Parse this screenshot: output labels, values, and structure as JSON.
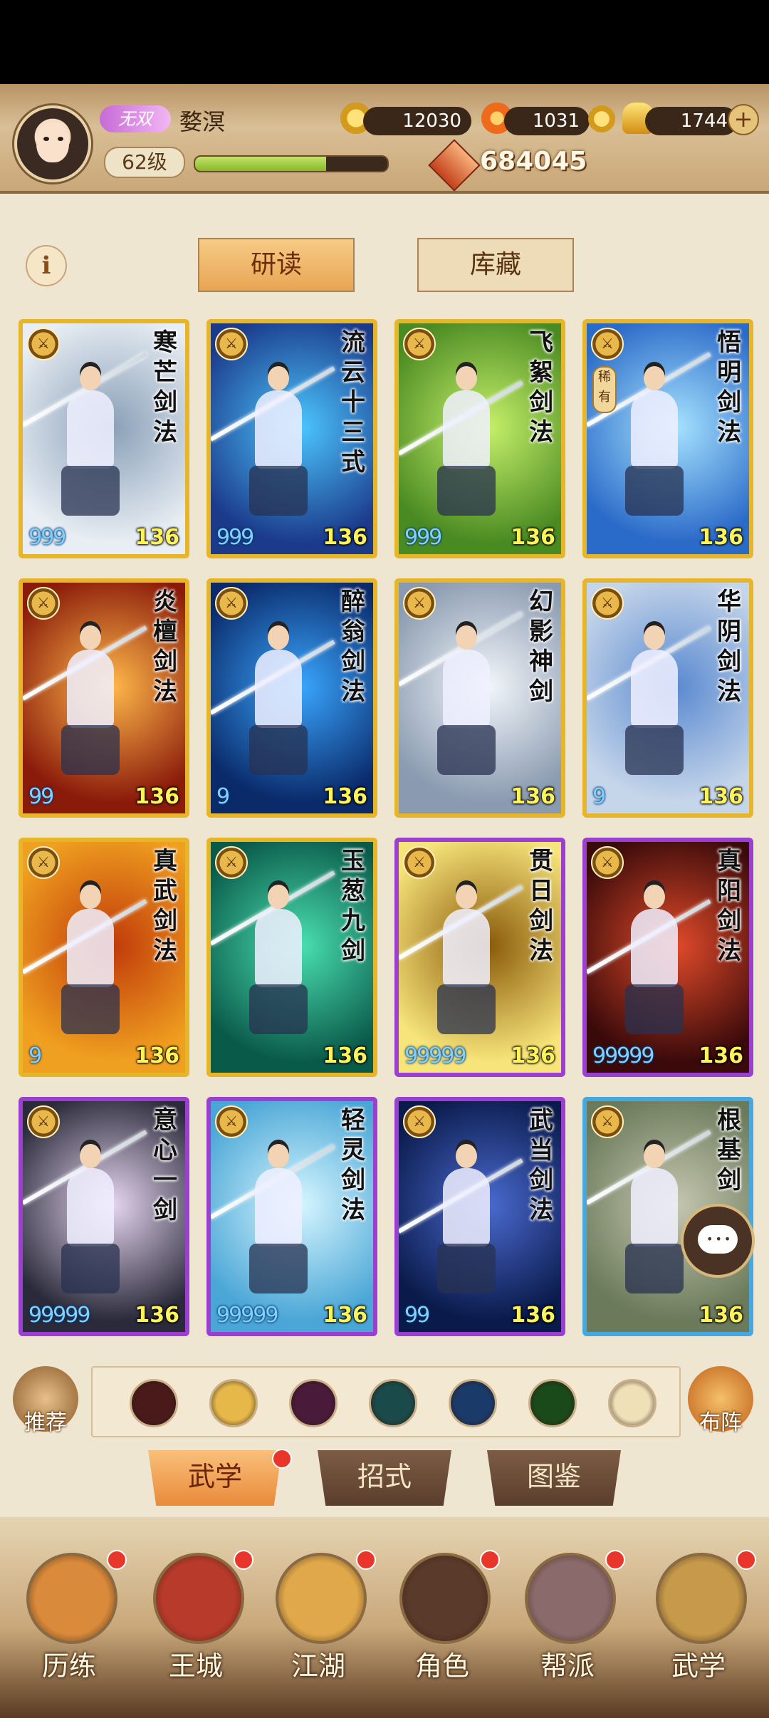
{
  "header": {
    "vip_label": "无双",
    "player_name": "婺溟",
    "level_label": "62级",
    "xp_fraction": 0.68,
    "coins": "12030",
    "flame": "1031",
    "gold": "1744",
    "power": "684045"
  },
  "top_buttons": {
    "research": "研读",
    "storage": "库藏"
  },
  "cards": [
    {
      "title": "寒芒剑法",
      "stars": "999",
      "level": "136",
      "rarity": "gold",
      "rare": false
    },
    {
      "title": "流云十三式",
      "stars": "999",
      "level": "136",
      "rarity": "gold",
      "rare": false
    },
    {
      "title": "飞絮剑法",
      "stars": "999",
      "level": "136",
      "rarity": "gold",
      "rare": false
    },
    {
      "title": "悟明剑法",
      "stars": "",
      "level": "136",
      "rarity": "gold",
      "rare": true,
      "rare_label": "稀有"
    },
    {
      "title": "炎檀剑法",
      "stars": "99",
      "level": "136",
      "rarity": "gold",
      "rare": false
    },
    {
      "title": "醉翁剑法",
      "stars": "9",
      "level": "136",
      "rarity": "gold",
      "rare": false
    },
    {
      "title": "幻影神剑",
      "stars": "",
      "level": "136",
      "rarity": "gold",
      "rare": false
    },
    {
      "title": "华阴剑法",
      "stars": "9",
      "level": "136",
      "rarity": "gold",
      "rare": false
    },
    {
      "title": "真武剑法",
      "stars": "9",
      "level": "136",
      "rarity": "gold",
      "rare": false
    },
    {
      "title": "玉葱九剑",
      "stars": "",
      "level": "136",
      "rarity": "gold",
      "rare": false
    },
    {
      "title": "贯日剑法",
      "stars": "99999",
      "level": "136",
      "rarity": "purple",
      "rare": false
    },
    {
      "title": "真阳剑法",
      "stars": "99999",
      "level": "136",
      "rarity": "purple",
      "rare": false
    },
    {
      "title": "意心一剑",
      "stars": "99999",
      "level": "136",
      "rarity": "purple",
      "rare": false
    },
    {
      "title": "轻灵剑法",
      "stars": "99999",
      "level": "136",
      "rarity": "purple",
      "rare": false
    },
    {
      "title": "武当剑法",
      "stars": "99",
      "level": "136",
      "rarity": "purple",
      "rare": false
    },
    {
      "title": "根基剑",
      "stars": "",
      "level": "136",
      "rarity": "blue",
      "rare": false
    }
  ],
  "card_palettes": [
    "#e8eef4,#8aa0b8",
    "#1b3a8a,#4cc6ff",
    "#4a8a22,#c6f06a",
    "#2a6ac8,#a6e2ff",
    "#8a1a0a,#ffb84a",
    "#0a2a6a,#3aa6ff",
    "#8a9ab0,#f2f6fa",
    "#c6d6ea,#5a8ad0",
    "#f0a020,#c03a0a",
    "#0a5a4a,#4ae0b0",
    "#f7e47a,#8a5a0a",
    "#3a0a0a,#e04a2a",
    "#2a2a3a,#e6d6f0",
    "#4aa6d6,#d6f6ff",
    "#0a1a4a,#4a6ad0",
    "#6a7a5a,#c6c6b0"
  ],
  "filters": {
    "recommend": "推荐",
    "formation": "布阵"
  },
  "filter_colors": [
    "#4a1a1a",
    "#e6b84a",
    "#4a1a3a",
    "#1a4a4a",
    "#1a3a6a",
    "#1a4a1a",
    "#f0e0b8"
  ],
  "tabs": {
    "martial": "武学",
    "moves": "招式",
    "codex": "图鉴"
  },
  "nav": [
    {
      "label": "历练",
      "color": "#d98a3a"
    },
    {
      "label": "王城",
      "color": "#b83a2a"
    },
    {
      "label": "江湖",
      "color": "#e0a84a"
    },
    {
      "label": "角色",
      "color": "#5a3a2a"
    },
    {
      "label": "帮派",
      "color": "#8a6a6a"
    },
    {
      "label": "武学",
      "color": "#c69a4a"
    }
  ]
}
